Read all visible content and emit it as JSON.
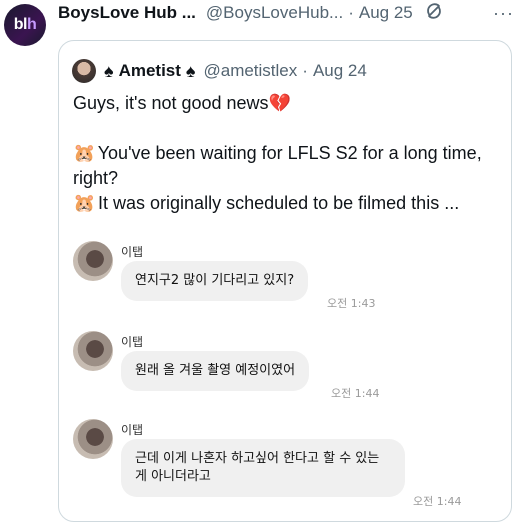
{
  "tweet": {
    "author_name": "BoysLove Hub ...",
    "author_handle": "@BoysLoveHub...",
    "separator": "·",
    "date": "Aug 25",
    "more": "···",
    "avatar_text": "bl",
    "avatar_text2": "h"
  },
  "quoted": {
    "spade": "♠",
    "name": "Ametist",
    "handle": "@ametistlex",
    "separator": "·",
    "date": "Aug 24",
    "line1": "Guys, it's not good news",
    "line2": "You've been waiting for LFLS S2 for a long time, right?",
    "line3": "It was originally scheduled to be filmed this ...",
    "heart_emoji": "💔",
    "hamster_emoji": "🐹"
  },
  "chats": [
    {
      "sender": "이탭",
      "message": "연지구2 많이 기다리고 있지?",
      "time": "오전 1:43"
    },
    {
      "sender": "이탭",
      "message": "원래 올 겨울 촬영 예정이였어",
      "time": "오전 1:44"
    },
    {
      "sender": "이탭",
      "message": "근데 이게 나혼자 하고싶어 한다고 할 수 있는 게 아니더라고",
      "time": "오전 1:44"
    }
  ]
}
